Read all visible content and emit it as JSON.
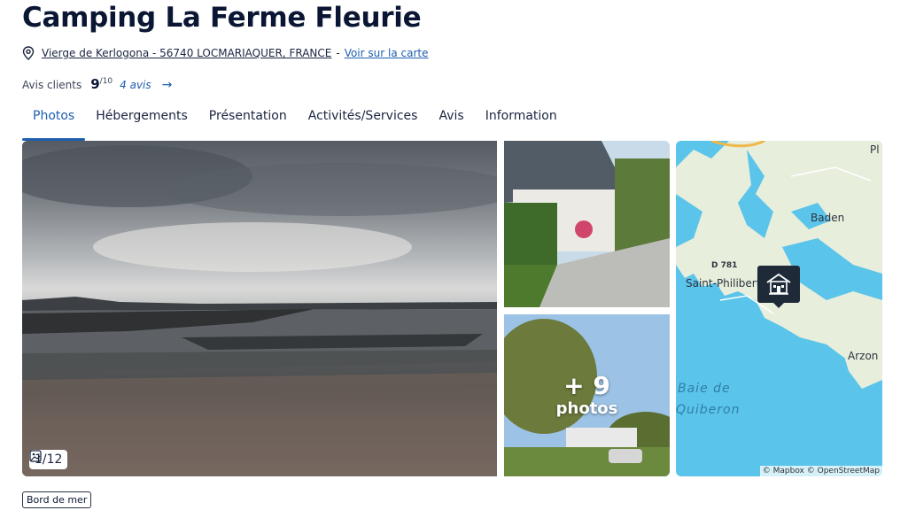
{
  "header": {
    "title": "Camping La Ferme Fleurie",
    "address": "Vierge de Kerlogona - 56740 LOCMARIAQUER, FRANCE",
    "separator": "-",
    "map_link": "Voir sur la carte",
    "location_icon": "map-pin-outline-icon"
  },
  "rating": {
    "label": "Avis clients",
    "score": "9",
    "out_of": "/10",
    "reviews": "4 avis",
    "arrow": "→"
  },
  "tabs": [
    {
      "label": "Photos",
      "active": true
    },
    {
      "label": "Hébergements"
    },
    {
      "label": "Présentation"
    },
    {
      "label": "Activités/Services"
    },
    {
      "label": "Avis"
    },
    {
      "label": "Information"
    }
  ],
  "gallery": {
    "counter": "1/12",
    "more_count": "+ 9",
    "more_label": "photos"
  },
  "map": {
    "labels": {
      "pl": "Pl",
      "baden": "Baden",
      "d781": "D 781",
      "saint_philibert": "Saint-Philibert",
      "arzon": "Arzon",
      "baie": "Baie de",
      "quiberon": "Quiberon"
    },
    "attribution": "© Mapbox © OpenStreetMap",
    "pin_icon": "campsite-house-icon"
  },
  "tag": "Bord de mer",
  "colors": {
    "accent": "#1f5fae",
    "title": "#0a1633",
    "water": "#5bc4ea",
    "land": "#e9f0dd"
  }
}
